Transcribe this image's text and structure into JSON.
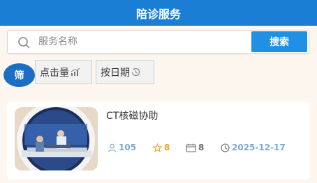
{
  "header": {
    "title": "陪诊服务"
  },
  "search": {
    "placeholder": "服务名称",
    "button_label": "搜索"
  },
  "filters": {
    "filter_label": "筛",
    "sort_by_clicks": "点击量",
    "sort_by_date": "按日期"
  },
  "services": [
    {
      "title": "CT核磁协助",
      "views": "105",
      "rating": "8",
      "count": "8",
      "date": "2025-12-17"
    }
  ],
  "colors": {
    "header_bg": "#1a7fd4",
    "accent": "#1e90e6",
    "rating": "#f0a020",
    "meta": "#7fa8d8"
  }
}
